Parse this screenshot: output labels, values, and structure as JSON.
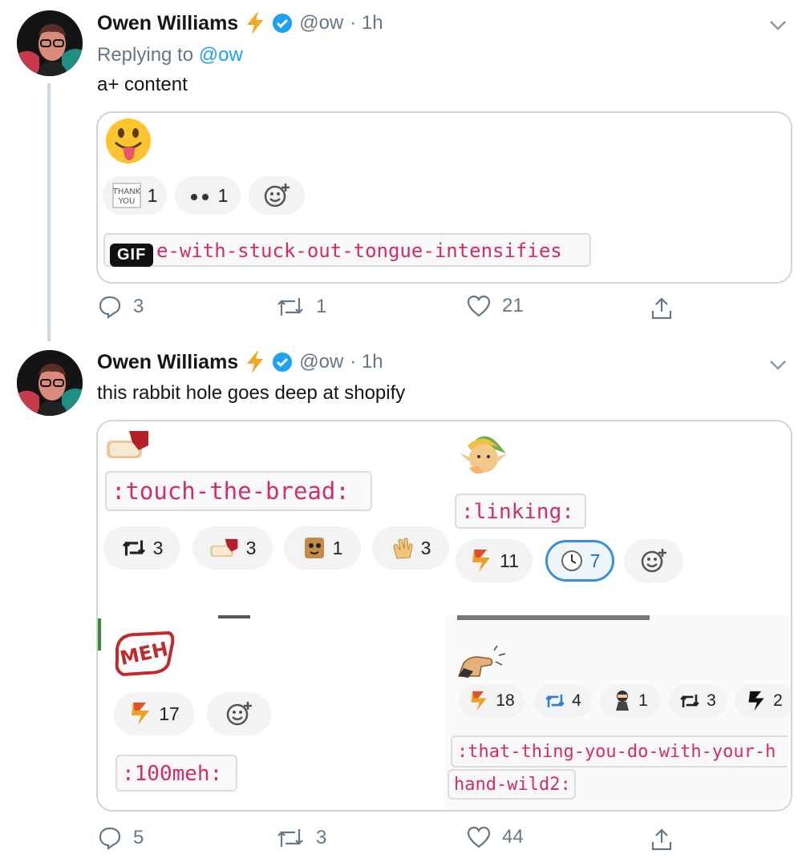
{
  "tweets": [
    {
      "name": "Owen Williams",
      "handle": "@ow",
      "time": "· 1h",
      "replying_prefix": "Replying to ",
      "replying_handle": "@ow",
      "text": "a+ content",
      "card": {
        "reactions": [
          {
            "icon": "thank-you-icon",
            "count": "1"
          },
          {
            "icon": "eyes-icon",
            "count": "1"
          }
        ],
        "code": "e-with-stuck-out-tongue-intensifies",
        "gif_label": "GIF"
      },
      "actions": {
        "replies": "3",
        "retweets": "1",
        "likes": "21"
      }
    },
    {
      "name": "Owen Williams",
      "handle": "@ow",
      "time": "· 1h",
      "text": "this rabbit hole goes deep at shopify",
      "card": {
        "q1": {
          "code": ":touch-the-bread:",
          "reactions": [
            {
              "icon": "retweet-icon",
              "count": "3"
            },
            {
              "icon": "bread-icon",
              "count": "3"
            },
            {
              "icon": "cat-toast-icon",
              "count": "1"
            },
            {
              "icon": "clap-icon",
              "count": "3"
            }
          ]
        },
        "q2": {
          "code": ":linking:",
          "reactions": [
            {
              "icon": "shopify-r-icon",
              "count": "11"
            },
            {
              "icon": "clock-face-icon",
              "count": "7"
            }
          ]
        },
        "q3": {
          "code": ":100meh:",
          "reactions": [
            {
              "icon": "shopify-r-icon",
              "count": "17"
            }
          ]
        },
        "q4": {
          "code_line1": ":that-thing-you-do-with-your-h",
          "code_line2": "hand-wild2:",
          "reactions": [
            {
              "icon": "shopify-r-icon",
              "count": "18"
            },
            {
              "icon": "retweet-blue-icon",
              "count": "4"
            },
            {
              "icon": "ninja-icon",
              "count": "1"
            },
            {
              "icon": "retweet-icon",
              "count": "3"
            },
            {
              "icon": "black-r-icon",
              "count": "2"
            }
          ]
        }
      },
      "actions": {
        "replies": "5",
        "retweets": "3",
        "likes": "44"
      }
    }
  ],
  "colors": {
    "link": "#1da1f2",
    "verified": "#1da1f2",
    "lightning": "#f5a623",
    "code": "#d22e5f",
    "muted": "#657786"
  }
}
